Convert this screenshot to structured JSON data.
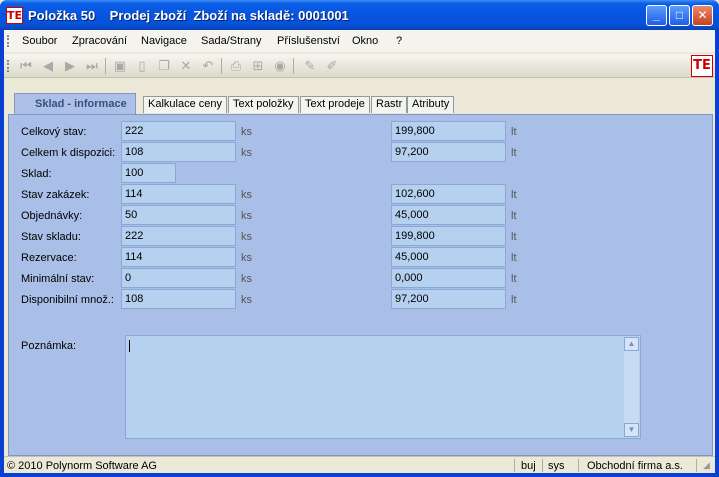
{
  "window": {
    "title": "Položka 50    Prodej zboží  Zboží na skladě: 0001001",
    "app_icon": "TE",
    "controls": {
      "minimize": "_",
      "maximize": "□",
      "close": "✕"
    }
  },
  "menu": [
    "Soubor",
    "Zpracování",
    "Navigace",
    "Sada/Strany",
    "Příslušenství",
    "Okno",
    "?"
  ],
  "toolbar": {
    "icons": [
      "first-record-icon",
      "previous-record-icon",
      "next-record-icon",
      "last-record-icon",
      "save-icon",
      "new-document-icon",
      "copy-icon",
      "delete-icon",
      "undo-icon",
      "print-icon",
      "tree-icon",
      "disc-icon",
      "edit-icon",
      "edit-alt-icon"
    ],
    "brand_logo": "TE"
  },
  "tabs": [
    "Sklad - informace",
    "Kalkulace ceny",
    "Text položky",
    "Text prodeje",
    "Rastr",
    "Atributy"
  ],
  "active_tab": 0,
  "rows": [
    {
      "label": "Celkový stav:",
      "value": "222",
      "unit": "ks",
      "value2": "199,800",
      "unit2": "lt"
    },
    {
      "label": "Celkem k dispozici:",
      "value": "108",
      "unit": "ks",
      "value2": "97,200",
      "unit2": "lt"
    },
    {
      "label": "Sklad:",
      "value": "100",
      "unit": "",
      "value2": "",
      "unit2": ""
    },
    {
      "label": "Stav zakázek:",
      "value": "114",
      "unit": "ks",
      "value2": "102,600",
      "unit2": "lt"
    },
    {
      "label": "Objednávky:",
      "value": "50",
      "unit": "ks",
      "value2": "45,000",
      "unit2": "lt"
    },
    {
      "label": "Stav skladu:",
      "value": "222",
      "unit": "ks",
      "value2": "199,800",
      "unit2": "lt"
    },
    {
      "label": "Rezervace:",
      "value": "114",
      "unit": "ks",
      "value2": "45,000",
      "unit2": "lt"
    },
    {
      "label": "Minimální stav:",
      "value": "0",
      "unit": "ks",
      "value2": "0,000",
      "unit2": "lt"
    },
    {
      "label": "Disponibilní množ.:",
      "value": "108",
      "unit": "ks",
      "value2": "97,200",
      "unit2": "lt"
    }
  ],
  "note": {
    "label": "Poznámka:",
    "value": ""
  },
  "status": {
    "copyright": "© 2010 Polynorm Software AG",
    "user": "buj",
    "system": "sys",
    "company": "Obchodní firma a.s."
  }
}
